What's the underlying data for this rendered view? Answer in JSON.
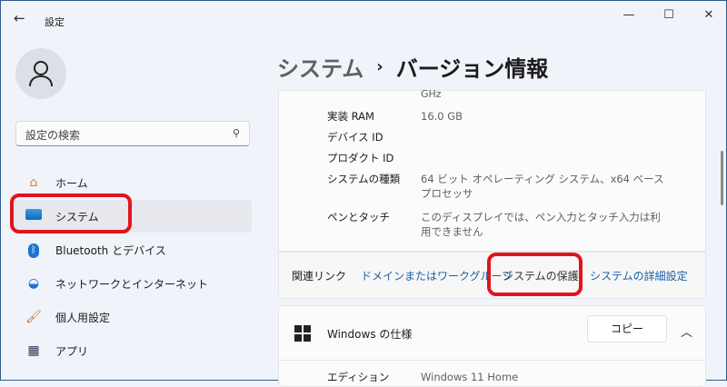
{
  "window": {
    "title": "設定",
    "back_icon": "arrow-left",
    "minimize": "—",
    "maximize": "☐",
    "close": "✕"
  },
  "sidebar": {
    "search_placeholder": "設定の検索",
    "items": [
      {
        "label": "ホーム",
        "icon": "home-icon"
      },
      {
        "label": "システム",
        "icon": "monitor-icon"
      },
      {
        "label": "Bluetooth とデバイス",
        "icon": "bluetooth-icon"
      },
      {
        "label": "ネットワークとインターネット",
        "icon": "wifi-icon"
      },
      {
        "label": "個人用設定",
        "icon": "brush-icon"
      },
      {
        "label": "アプリ",
        "icon": "apps-icon"
      }
    ],
    "selected": "システム"
  },
  "breadcrumb": {
    "parent": "システム",
    "separator": "›",
    "current": "バージョン情報"
  },
  "device_specs": {
    "truncated_value": "GHz",
    "rows": [
      {
        "key": "実装 RAM",
        "value": "16.0 GB"
      },
      {
        "key": "デバイス ID",
        "value": ""
      },
      {
        "key": "プロダクト ID",
        "value": ""
      },
      {
        "key": "システムの種類",
        "value": "64 ビット オペレーティング システム、x64 ベース プロセッサ"
      },
      {
        "key": "ペンとタッチ",
        "value": "このディスプレイでは、ペン入力とタッチ入力は利用できません"
      }
    ]
  },
  "related_links": {
    "label": "関連リンク",
    "links": [
      "ドメインまたはワークグループ",
      "システムの保護",
      "システムの詳細設定"
    ]
  },
  "windows_spec": {
    "title": "Windows の仕様",
    "copy_label": "コピー",
    "rows": [
      {
        "key": "エディション",
        "value": "Windows 11 Home"
      }
    ]
  }
}
